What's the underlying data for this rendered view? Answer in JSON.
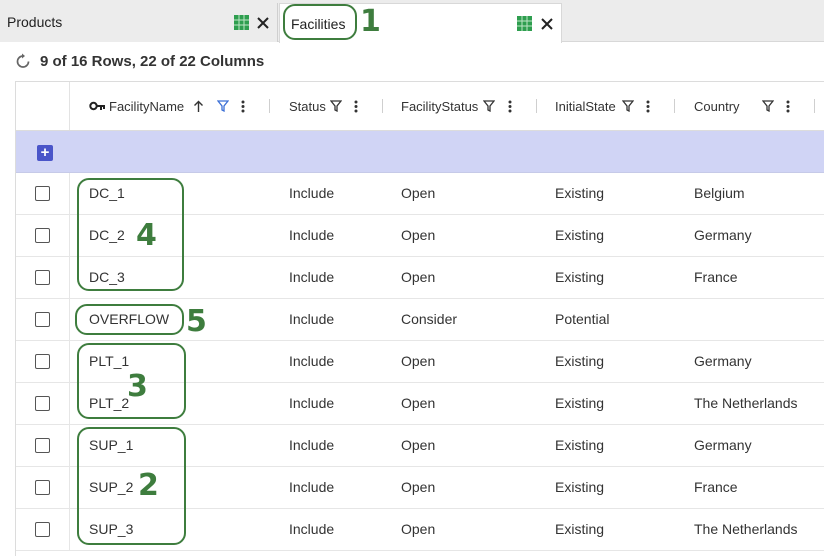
{
  "tabs": [
    {
      "label": "Products"
    },
    {
      "label": "Facilities"
    }
  ],
  "status": {
    "row_count_text": "9 of 16 Rows, 22 of 22 Columns"
  },
  "grid": {
    "columns": [
      {
        "label": "FacilityName",
        "icons": [
          "key-icon",
          "sort-ascending-icon",
          "filter-icon",
          "more-vertical-icon"
        ]
      },
      {
        "label": "Status",
        "icons": [
          "filter-icon",
          "more-vertical-icon"
        ]
      },
      {
        "label": "FacilityStatus",
        "icons": [
          "filter-icon",
          "more-vertical-icon"
        ]
      },
      {
        "label": "InitialState",
        "icons": [
          "filter-icon",
          "more-vertical-icon"
        ]
      },
      {
        "label": "Country",
        "icons": [
          "filter-icon",
          "more-vertical-icon"
        ]
      }
    ],
    "add_button_label": "+",
    "rows": [
      {
        "name": "DC_1",
        "status": "Include",
        "facility_status": "Open",
        "initial_state": "Existing",
        "country": "Belgium"
      },
      {
        "name": "DC_2",
        "status": "Include",
        "facility_status": "Open",
        "initial_state": "Existing",
        "country": "Germany"
      },
      {
        "name": "DC_3",
        "status": "Include",
        "facility_status": "Open",
        "initial_state": "Existing",
        "country": "France"
      },
      {
        "name": "OVERFLOW",
        "status": "Include",
        "facility_status": "Consider",
        "initial_state": "Potential",
        "country": ""
      },
      {
        "name": "PLT_1",
        "status": "Include",
        "facility_status": "Open",
        "initial_state": "Existing",
        "country": "Germany"
      },
      {
        "name": "PLT_2",
        "status": "Include",
        "facility_status": "Open",
        "initial_state": "Existing",
        "country": "The Netherlands"
      },
      {
        "name": "SUP_1",
        "status": "Include",
        "facility_status": "Open",
        "initial_state": "Existing",
        "country": "Germany"
      },
      {
        "name": "SUP_2",
        "status": "Include",
        "facility_status": "Open",
        "initial_state": "Existing",
        "country": "France"
      },
      {
        "name": "SUP_3",
        "status": "Include",
        "facility_status": "Open",
        "initial_state": "Existing",
        "country": "The Netherlands"
      }
    ]
  },
  "annotations": [
    {
      "number": "1"
    },
    {
      "number": "2"
    },
    {
      "number": "3"
    },
    {
      "number": "4"
    },
    {
      "number": "5"
    }
  ],
  "colors": {
    "annotation": "#3e7d3e",
    "add_row_band": "#d0d4f5",
    "add_button": "#4a55c9",
    "filter_icon_active": "#3b6fd6",
    "grid_icon": "#2e9e4f"
  }
}
